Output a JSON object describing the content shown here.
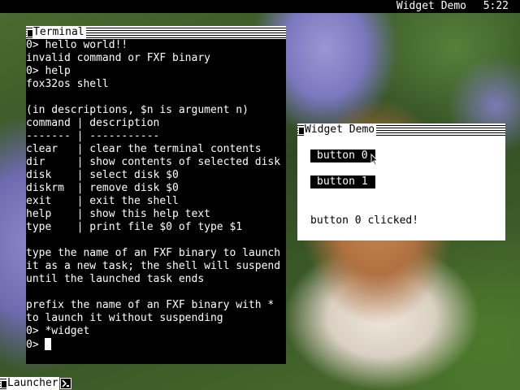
{
  "topbar": {
    "active_title": "Widget Demo",
    "clock": "5:22"
  },
  "terminal": {
    "title": "Terminal",
    "lines": [
      "0> hello world!!",
      "invalid command or FXF binary",
      "0> help",
      "fox32os shell",
      "",
      "(in descriptions, $n is argument n)",
      "command | description",
      "------- | -----------",
      "clear   | clear the terminal contents",
      "dir     | show contents of selected disk",
      "disk    | select disk $0",
      "diskrm  | remove disk $0",
      "exit    | exit the shell",
      "help    | show this help text",
      "type    | print file $0 of type $1",
      "",
      "type the name of an FXF binary to launch",
      "it as a new task; the shell will suspend",
      "until the launched task ends",
      "",
      "prefix the name of an FXF binary with *",
      "to launch it without suspending",
      "0> *widget"
    ],
    "prompt": "0> "
  },
  "widget_demo": {
    "title": "Widget Demo",
    "button0_label": "button 0",
    "button1_label": "button 1",
    "status_text": "button 0 clicked!"
  },
  "dock": {
    "launcher_label": "Launcher",
    "terminal_icon": "terminal-icon"
  }
}
